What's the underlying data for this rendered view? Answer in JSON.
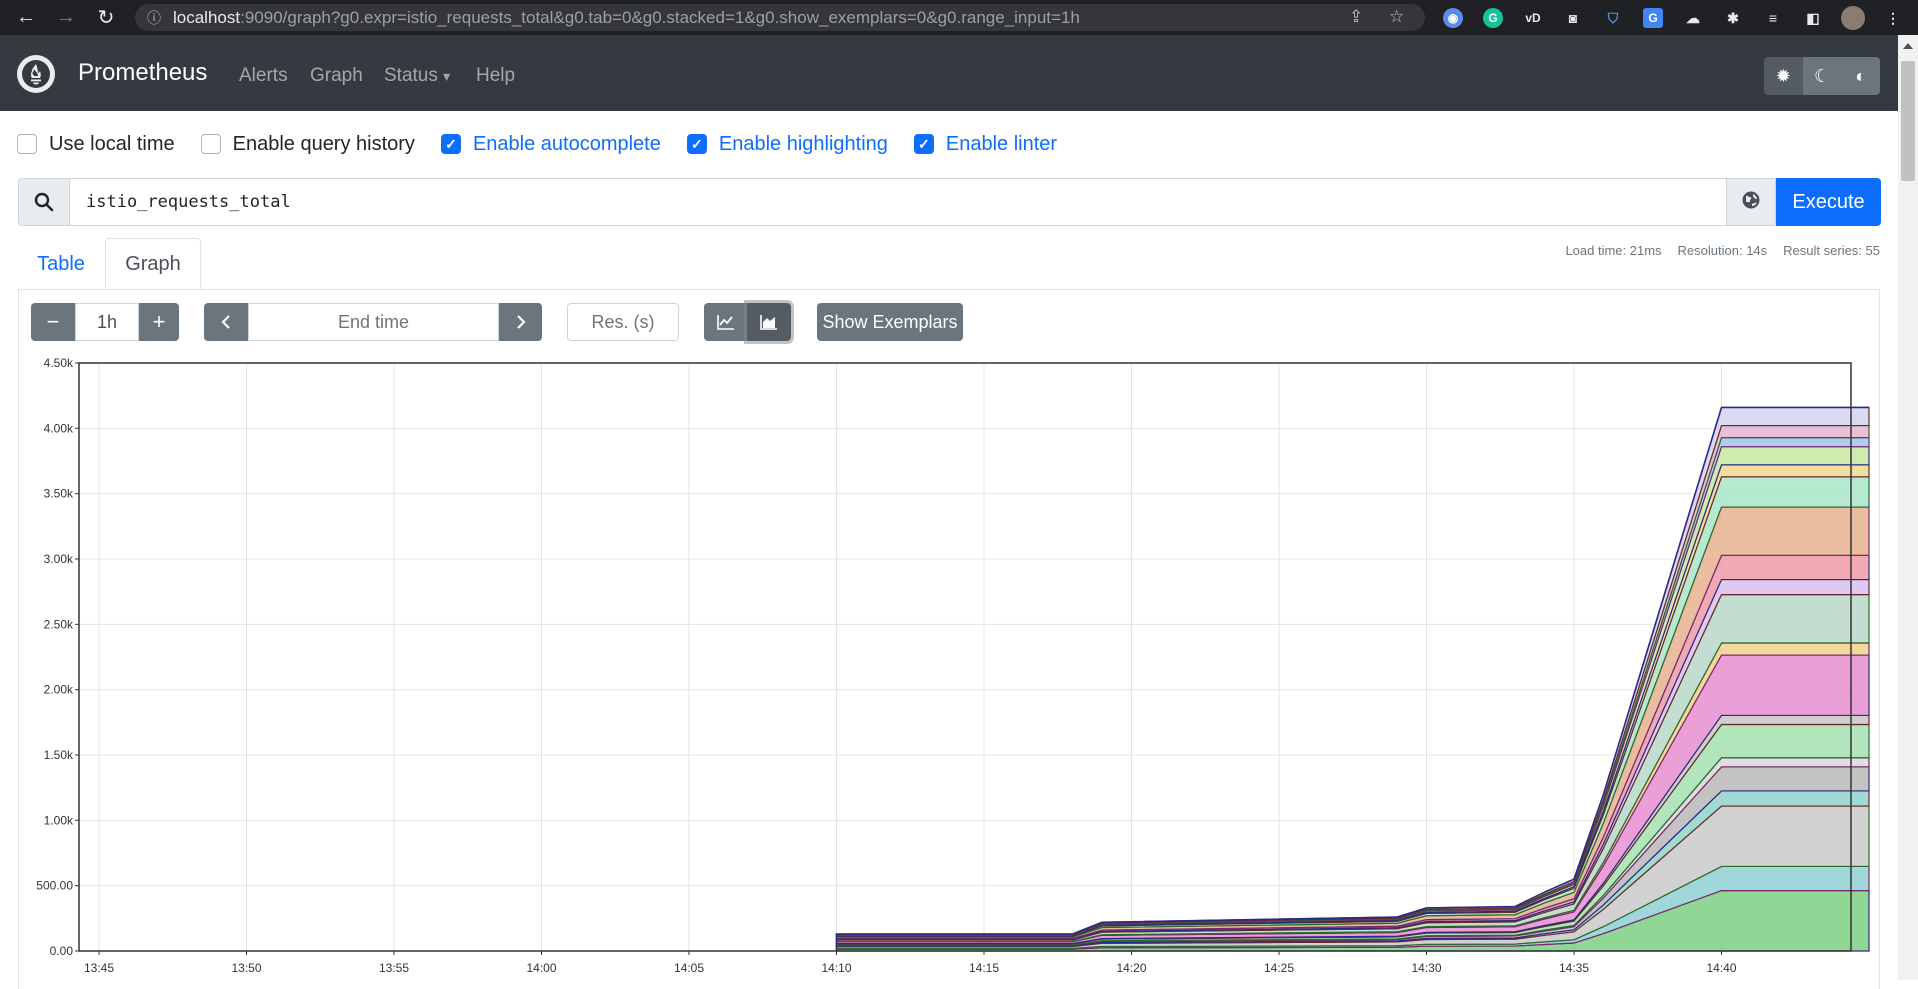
{
  "browser": {
    "url_host": "localhost",
    "url_rest": ":9090/graph?g0.expr=istio_requests_total&g0.tab=0&g0.stacked=1&g0.show_exemplars=0&g0.range_input=1h",
    "back_icon": "arrow-left-icon",
    "forward_icon": "arrow-right-icon",
    "reload_icon": "reload-icon"
  },
  "navbar": {
    "brand": "Prometheus",
    "links": [
      "Alerts",
      "Graph",
      "Status",
      "Help"
    ],
    "status_caret": "▾"
  },
  "options": [
    {
      "label": "Use local time",
      "checked": false
    },
    {
      "label": "Enable query history",
      "checked": false
    },
    {
      "label": "Enable autocomplete",
      "checked": true
    },
    {
      "label": "Enable highlighting",
      "checked": true
    },
    {
      "label": "Enable linter",
      "checked": true
    }
  ],
  "query": {
    "expression": "istio_requests_total",
    "execute_label": "Execute"
  },
  "tabs": {
    "table": "Table",
    "graph": "Graph"
  },
  "stats": {
    "load_time": "Load time: 21ms",
    "resolution": "Resolution: 14s",
    "result_series": "Result series: 55"
  },
  "controls": {
    "minus": "−",
    "range": "1h",
    "plus": "+",
    "prev": "‹",
    "end_time_placeholder": "End time",
    "next": "›",
    "resolution_placeholder": "Res. (s)",
    "show_exemplars": "Show Exemplars"
  },
  "chart_data": {
    "type": "area",
    "stacked": true,
    "series_count": 55,
    "x_ticks": [
      "13:45",
      "13:50",
      "13:55",
      "14:00",
      "14:05",
      "14:10",
      "14:15",
      "14:20",
      "14:25",
      "14:30",
      "14:35",
      "14:40"
    ],
    "y_ticks": [
      "0.00",
      "500.00",
      "1.00k",
      "1.50k",
      "2.00k",
      "2.50k",
      "3.00k",
      "3.50k",
      "4.00k",
      "4.50k"
    ],
    "ylim": [
      0,
      4500
    ],
    "grid": true,
    "total_stack": {
      "x": [
        "14:10",
        "14:18",
        "14:19",
        "14:29",
        "14:30",
        "14:33",
        "14:34",
        "14:35",
        "14:36",
        "14:40",
        "14:45"
      ],
      "values": [
        130,
        130,
        220,
        260,
        330,
        340,
        450,
        550,
        1200,
        4160,
        4160
      ]
    },
    "band_colors": [
      "#7ccf82",
      "#8fd0d5",
      "#c9c9c9",
      "#8fd3cb",
      "#b8b8b8",
      "#d9d9d9",
      "#a3e0b0",
      "#c7c7c7",
      "#e88ed0",
      "#f2d08a",
      "#b8d8c8",
      "#d9c0ee",
      "#ef9aa6",
      "#e6b08f",
      "#a8e6c8",
      "#f0d88f",
      "#c7e8a0",
      "#9fc5f0",
      "#e8b4d0",
      "#d2d2f0"
    ]
  }
}
